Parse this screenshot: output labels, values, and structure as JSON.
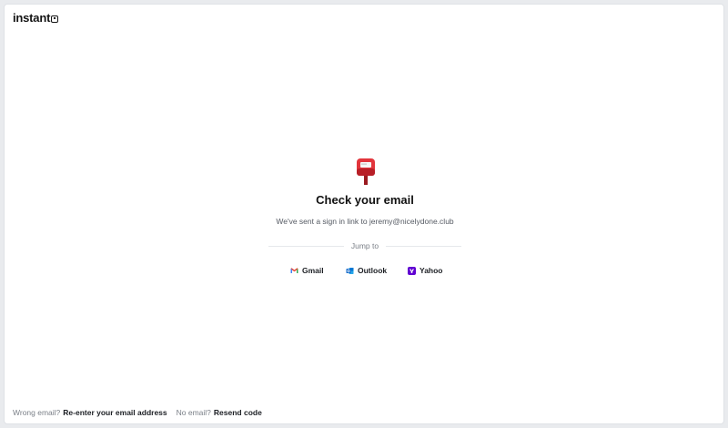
{
  "app": {
    "logo_text": "instant"
  },
  "main": {
    "icon": "postbox-icon",
    "title": "Check your email",
    "subtitle": "We've sent a sign in link to jeremy@nicelydone.club",
    "divider_label": "Jump to",
    "providers": [
      {
        "name": "Gmail",
        "icon": "gmail-icon"
      },
      {
        "name": "Outlook",
        "icon": "outlook-icon"
      },
      {
        "name": "Yahoo",
        "icon": "yahoo-icon"
      }
    ]
  },
  "footer": {
    "wrong_email_prompt": "Wrong email?",
    "wrong_email_link": "Re-enter your email address",
    "no_email_prompt": "No email?",
    "no_email_link": "Resend code"
  },
  "colors": {
    "postbox_red": "#d8262e",
    "gmail_red": "#ea4335",
    "outlook_blue": "#0a64c8",
    "yahoo_purple": "#6001d2"
  }
}
